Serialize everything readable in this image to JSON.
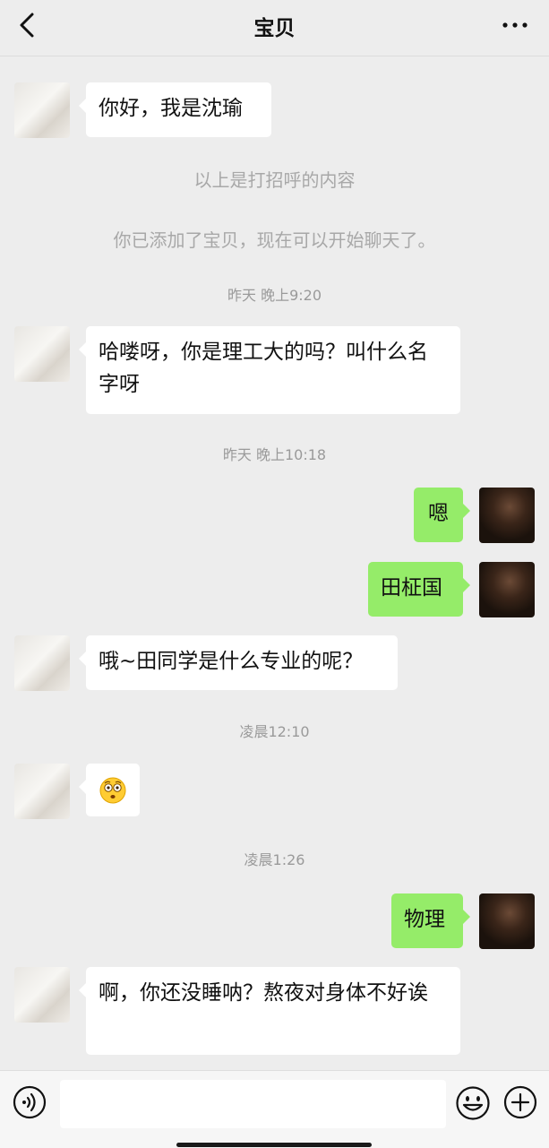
{
  "header": {
    "title": "宝贝",
    "back_icon": "chevron-left-icon",
    "more_icon": "more-horizontal-icon"
  },
  "messages": [
    {
      "side": "left",
      "text": "你好，我是沈瑜"
    },
    {
      "side": "left",
      "text": "哈喽呀，你是理工大的吗？叫什么名字呀"
    },
    {
      "side": "right",
      "text": "嗯"
    },
    {
      "side": "right",
      "text": "田柾国"
    },
    {
      "side": "left",
      "text": "哦~田同学是什么专业的呢？"
    },
    {
      "side": "left",
      "emoji": "astonished-face-emoji"
    },
    {
      "side": "right",
      "text": "物理"
    },
    {
      "side": "left",
      "text": "啊，你还没睡呐？熬夜对身体不好诶"
    }
  ],
  "system": {
    "greeting_notice": "以上是打招呼的内容",
    "added_notice": "你已添加了宝贝，现在可以开始聊天了。"
  },
  "timestamps": [
    "昨天 晚上9:20",
    "昨天 晚上10:18",
    "凌晨12:10",
    "凌晨1:26"
  ],
  "composer": {
    "voice_icon": "voice-icon",
    "input_value": "",
    "emoji_icon": "smiley-icon",
    "plus_icon": "plus-circle-icon"
  },
  "colors": {
    "background": "#ededed",
    "received_bubble": "#ffffff",
    "sent_bubble": "#95ec69",
    "system_text": "#a8a8a8"
  }
}
